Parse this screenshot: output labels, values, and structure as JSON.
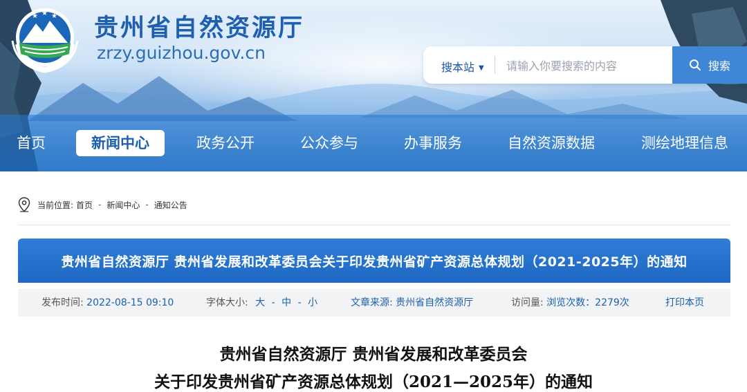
{
  "site": {
    "title": "贵州省自然资源厅",
    "url": "zrzy.guizhou.gov.cn"
  },
  "search": {
    "scope_label": "搜本站",
    "placeholder": "请输入你要搜索的内容",
    "button_label": "搜索"
  },
  "nav": {
    "items": [
      {
        "label": "首页"
      },
      {
        "label": "新闻中心"
      },
      {
        "label": "政务公开"
      },
      {
        "label": "公众参与"
      },
      {
        "label": "办事服务"
      },
      {
        "label": "自然资源数据"
      },
      {
        "label": "测绘地理信息"
      }
    ],
    "active_index": 1
  },
  "breadcrumb": {
    "prefix": "当前位置:",
    "items": [
      "首页",
      "新闻中心",
      "通知公告"
    ],
    "separator": "-"
  },
  "article": {
    "banner_title": "贵州省自然资源厅 贵州省发展和改革委员会关于印发贵州省矿产资源总体规划（2021-2025年）的通知",
    "meta": {
      "publish_label": "发布时间:",
      "publish_time": "2022-08-15 09:10",
      "font_size_label": "字体大小:",
      "font_large": "大",
      "font_medium": "中",
      "font_small": "小",
      "font_sep": "-",
      "source_label": "文章来源:",
      "source": "贵州省自然资源厅",
      "views_label": "访问量:",
      "views_text": "浏览次数：2279次",
      "print_label": "打印本页"
    },
    "doc_title_line1": "贵州省自然资源厅  贵州省发展和改革委员会",
    "doc_title_line2": "关于印发贵州省矿产资源总体规划（2021—2025年）的通知"
  },
  "colors": {
    "brand_blue": "#1d68c2",
    "nav_active_text": "#1a5fb0",
    "meta_bg": "#f2f3f5",
    "search_button": "#3f86d6"
  },
  "icons": {
    "logo": "emblem-mountain-stars-logo",
    "search": "search-icon",
    "caret": "caret-down-icon",
    "location": "location-pin-icon"
  }
}
